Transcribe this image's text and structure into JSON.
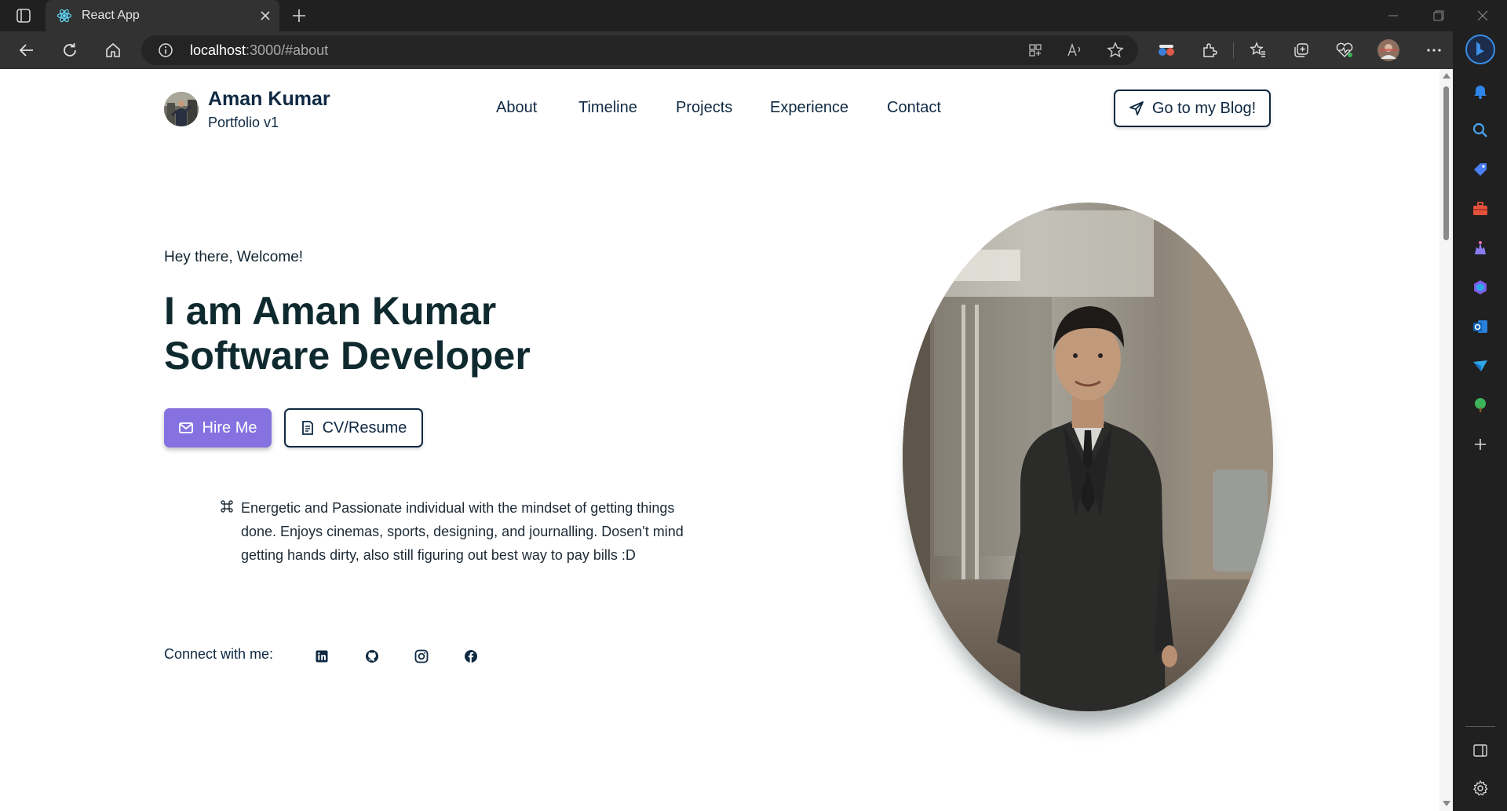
{
  "browser": {
    "tab_title": "React App",
    "url_host": "localhost",
    "url_rest": ":3000/#about"
  },
  "site": {
    "name": "Aman Kumar",
    "subtitle": "Portfolio v1",
    "nav": [
      {
        "label": "About"
      },
      {
        "label": "Timeline"
      },
      {
        "label": "Projects"
      },
      {
        "label": "Experience"
      },
      {
        "label": "Contact"
      }
    ],
    "blog_button": "Go to my Blog!"
  },
  "hero": {
    "greeting": "Hey there, Welcome!",
    "headline_line1": "I am Aman Kumar",
    "headline_line2": "Software Developer",
    "hire_button": "Hire Me",
    "cv_button": "CV/Resume",
    "bio": "Energetic and Passionate individual with the mindset of getting things done. Enjoys cinemas, sports, designing, and journalling. Dosen't mind getting hands dirty, also still figuring out best way to pay bills :D",
    "connect_label": "Connect with me:",
    "socials": [
      "linkedin-icon",
      "github-icon",
      "instagram-icon",
      "facebook-icon"
    ]
  },
  "colors": {
    "accent": "#8572e0",
    "navy": "#0f2942",
    "chrome_dark": "#202020"
  }
}
